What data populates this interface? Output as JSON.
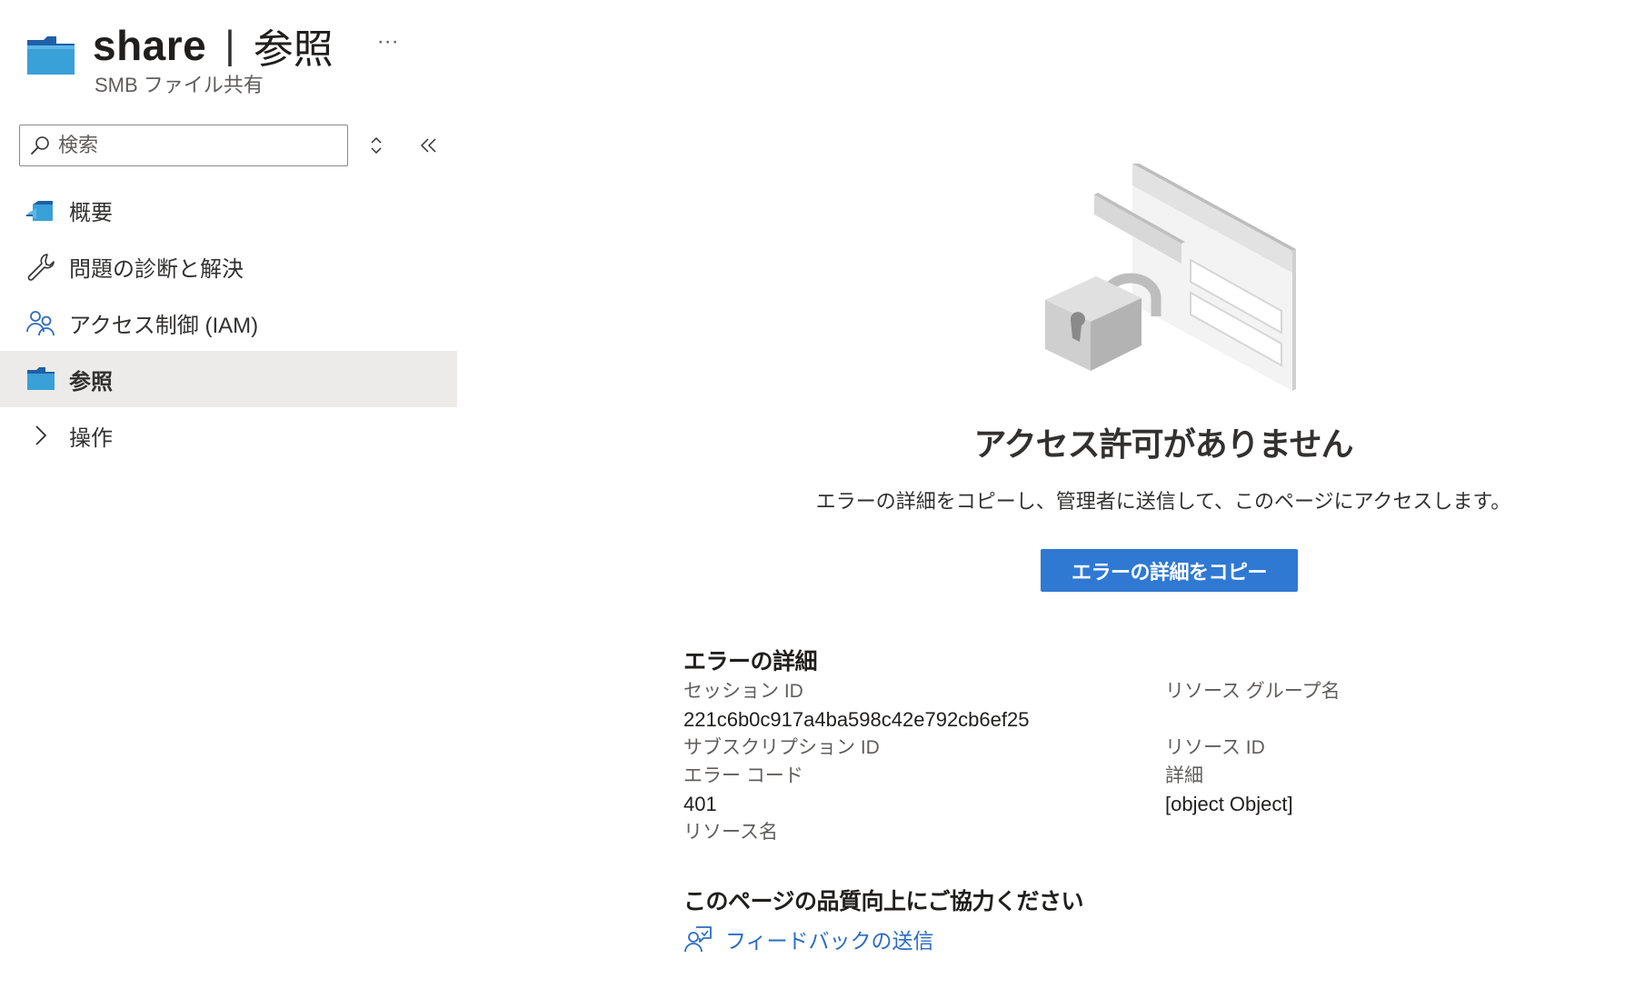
{
  "header": {
    "title": "share",
    "separator": "|",
    "section": "参照",
    "more": "···",
    "subtitle": "SMB ファイル共有"
  },
  "sidebar": {
    "search": {
      "placeholder": "検索",
      "value": ""
    },
    "items": [
      {
        "label": "概要",
        "icon": "overview-icon",
        "selected": false
      },
      {
        "label": "問題の診断と解決",
        "icon": "wrench-icon",
        "selected": false
      },
      {
        "label": "アクセス制御 (IAM)",
        "icon": "people-icon",
        "selected": false
      },
      {
        "label": "参照",
        "icon": "folder-icon",
        "selected": true
      },
      {
        "label": "操作",
        "icon": "chevron-right-icon",
        "selected": false
      }
    ]
  },
  "main": {
    "error_title": "アクセス許可がありません",
    "error_message": "エラーの詳細をコピーし、管理者に送信して、このページにアクセスします。",
    "copy_button": "エラーの詳細をコピー",
    "details": {
      "heading": "エラーの詳細",
      "session_id_label": "セッション ID",
      "session_id_value": "221c6b0c917a4ba598c42e792cb6ef25",
      "subscription_id_label": "サブスクリプション ID",
      "error_code_label": "エラー コード",
      "error_code_value": "401",
      "resource_name_label": "リソース名",
      "resource_group_label": "リソース グループ名",
      "resource_id_label": "リソース ID",
      "detail_label": "詳細",
      "detail_value": "[object Object]"
    },
    "feedback": {
      "heading": "このページの品質向上にご協力ください",
      "link": "フィードバックの送信"
    }
  },
  "colors": {
    "accent": "#2f79d3",
    "link": "#2b6cc4",
    "selected_bg": "#edebe9",
    "folder_blue": "#3aa0d8"
  }
}
